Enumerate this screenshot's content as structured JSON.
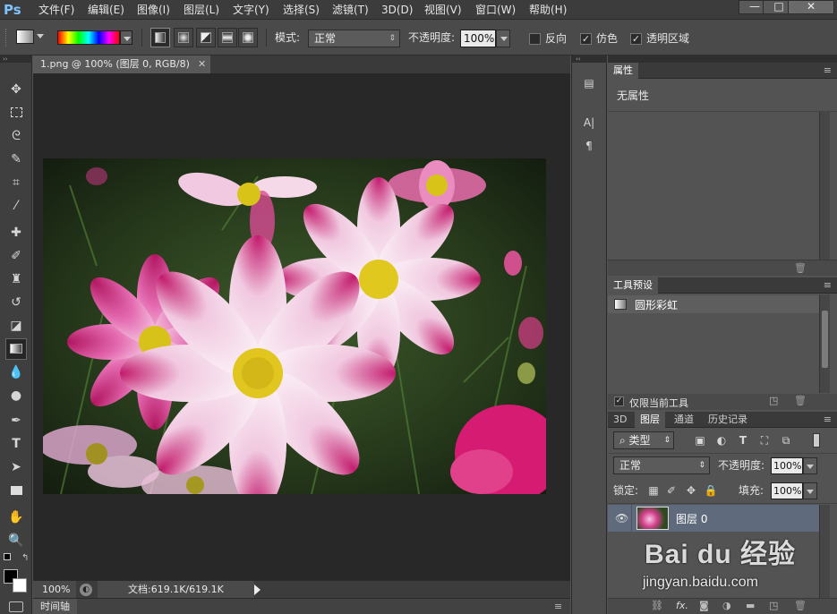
{
  "app": {
    "logo": "Ps"
  },
  "menu": [
    "文件(F)",
    "编辑(E)",
    "图像(I)",
    "图层(L)",
    "文字(Y)",
    "选择(S)",
    "滤镜(T)",
    "3D(D)",
    "视图(V)",
    "窗口(W)",
    "帮助(H)"
  ],
  "window_buttons": {
    "minimize": "—",
    "restore": "□",
    "close": "✕"
  },
  "options": {
    "mode_label": "模式:",
    "mode_value": "正常",
    "opacity_label": "不透明度:",
    "opacity_value": "100%",
    "reverse_label": "反向",
    "dither_label": "仿色",
    "transparency_label": "透明区域"
  },
  "document": {
    "tab_title": "1.png @ 100% (图层 0, RGB/8)",
    "zoom": "100%",
    "doc_size": "文档:619.1K/619.1K"
  },
  "timeline": {
    "label": "时间轴"
  },
  "properties": {
    "title": "属性",
    "body": "无属性"
  },
  "tool_presets": {
    "title": "工具预设",
    "item": "圆形彩虹",
    "current_only_label": "仅限当前工具"
  },
  "layers": {
    "tabs": [
      "3D",
      "图层",
      "通道",
      "历史记录"
    ],
    "active_tab": "图层",
    "filter_label": "类型",
    "blend_mode": "正常",
    "opacity_label": "不透明度:",
    "opacity_value": "100%",
    "lock_label": "锁定:",
    "fill_label": "填充:",
    "fill_value": "100%",
    "layer_name": "图层 0",
    "bottom_fx": "fx."
  },
  "watermark": {
    "brand": "Bai du 经验",
    "url": "jingyan.baidu.com"
  },
  "colors": {
    "accent": "#2d8cf0",
    "selected_layer": "#5f6b7d"
  }
}
